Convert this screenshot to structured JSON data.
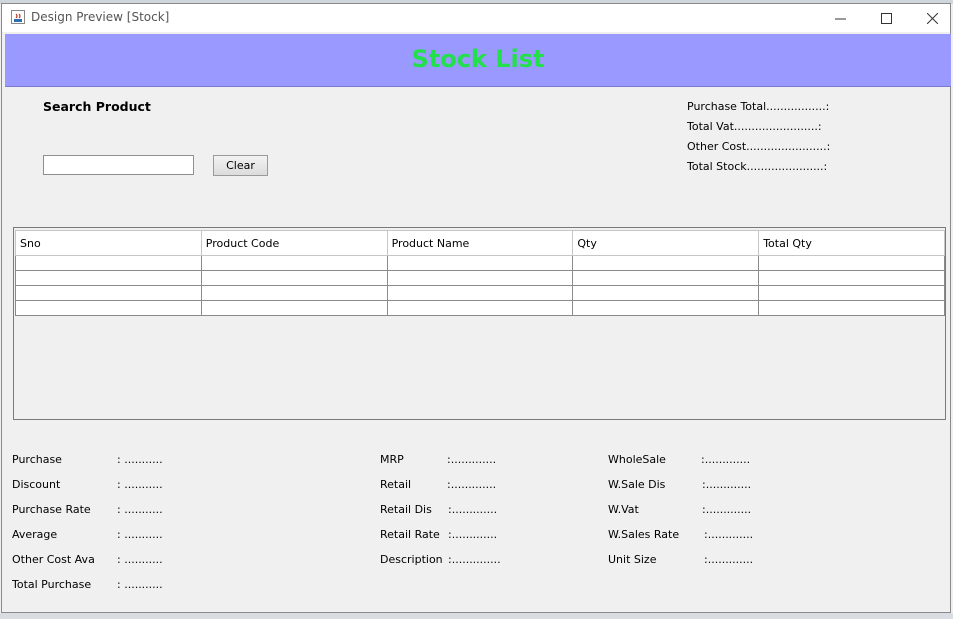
{
  "window": {
    "title": "Design Preview [Stock]"
  },
  "header": {
    "title": "Stock List"
  },
  "search": {
    "label": "Search Product",
    "value": "",
    "clear_label": "Clear"
  },
  "totals": [
    {
      "label": "Purchase Total.................:"
    },
    {
      "label": "Total Vat........................:"
    },
    {
      "label": "Other Cost.......................:"
    },
    {
      "label": "Total Stock......................:"
    }
  ],
  "table": {
    "columns": [
      "Sno",
      "Product Code",
      "Product Name",
      "Qty",
      "Total Qty"
    ],
    "rows": [
      [
        "",
        "",
        "",
        "",
        ""
      ],
      [
        "",
        "",
        "",
        "",
        ""
      ],
      [
        "",
        "",
        "",
        "",
        ""
      ],
      [
        "",
        "",
        "",
        "",
        ""
      ]
    ]
  },
  "details": {
    "col1": [
      {
        "label": "Purchase",
        "value": ":   ..........."
      },
      {
        "label": "Discount",
        "value": ":   ..........."
      },
      {
        "label": "Purchase Rate",
        "value": ":   ..........."
      },
      {
        "label": "Average",
        "value": ":   ..........."
      },
      {
        "label": "Other Cost Ava",
        "value": ":   ..........."
      },
      {
        "label": "Total Purchase",
        "value": ":   ..........."
      }
    ],
    "col2": [
      {
        "label": "MRP",
        "value": ":............."
      },
      {
        "label": "Retail",
        "value": ":............."
      },
      {
        "label": "Retail Dis",
        "value": ":............."
      },
      {
        "label": "Retail Rate",
        "value": ":............."
      },
      {
        "label": "Description",
        "value": ":.............."
      }
    ],
    "col3": [
      {
        "label": "WholeSale",
        "value": ":............."
      },
      {
        "label": "W.Sale Dis",
        "value": ":............."
      },
      {
        "label": "W.Vat",
        "value": ":............."
      },
      {
        "label": "W.Sales Rate",
        "value": ":............."
      },
      {
        "label": "Unit Size",
        "value": ":............."
      }
    ]
  }
}
